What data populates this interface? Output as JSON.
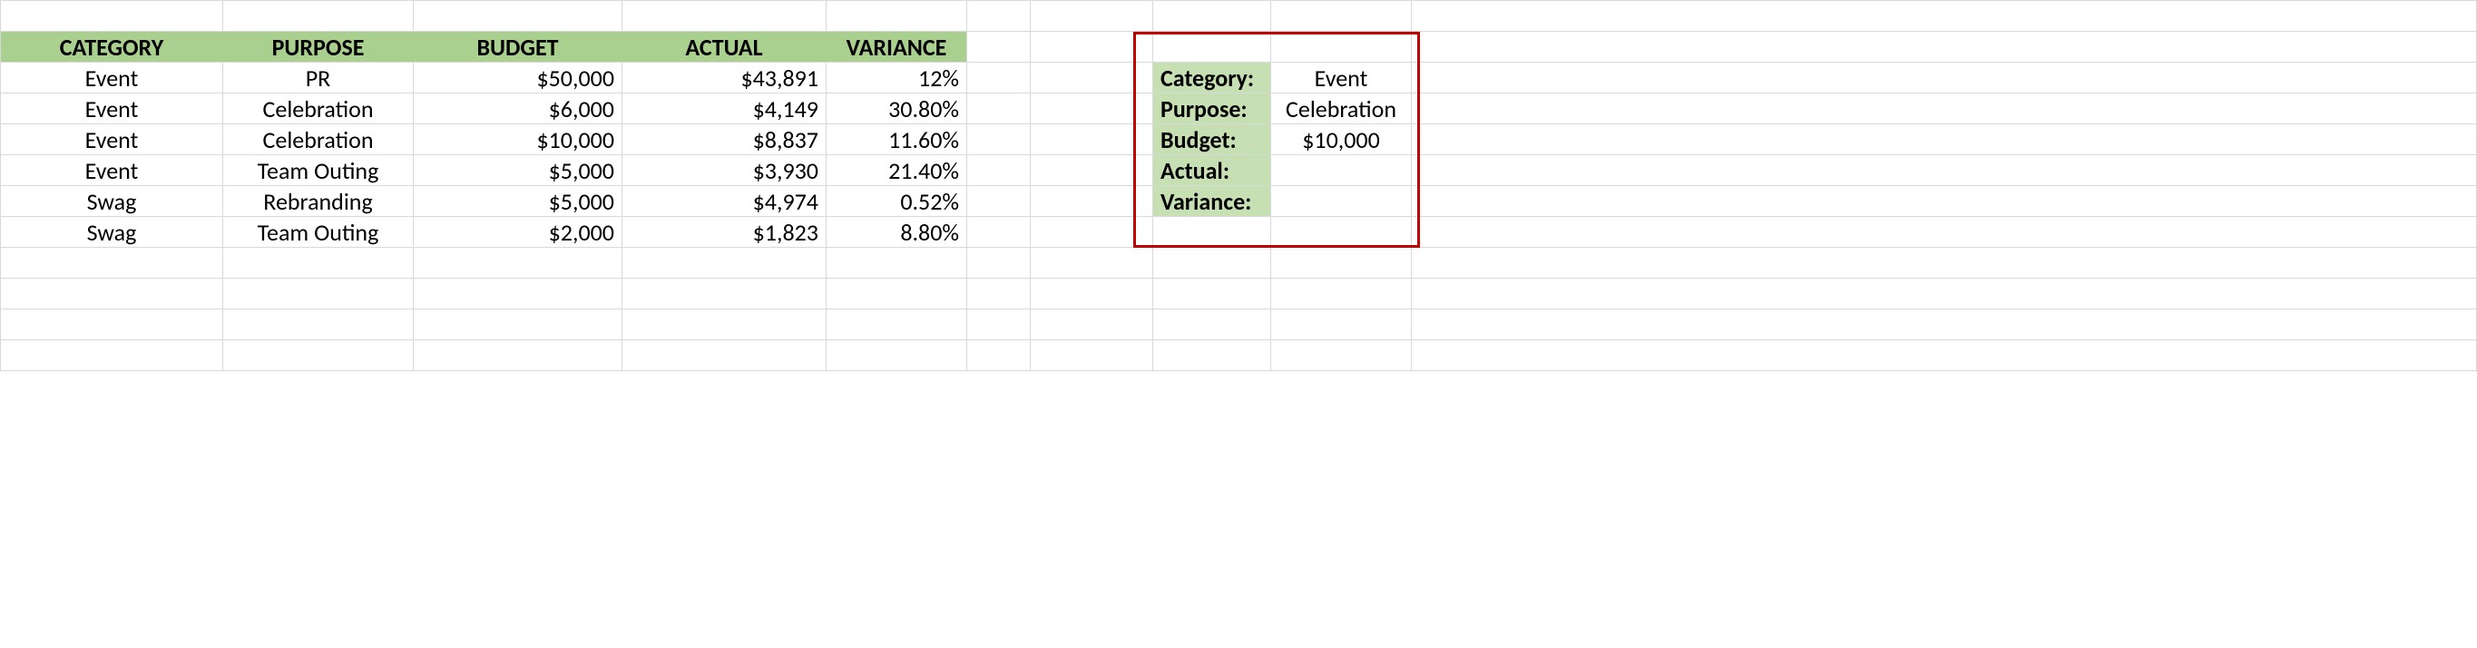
{
  "headers": {
    "category": "CATEGORY",
    "purpose": "PURPOSE",
    "budget": "BUDGET",
    "actual": "ACTUAL",
    "variance": "VARIANCE"
  },
  "rows": [
    {
      "category": "Event",
      "purpose": "PR",
      "budget": "$50,000",
      "actual": "$43,891",
      "variance": "12%"
    },
    {
      "category": "Event",
      "purpose": "Celebration",
      "budget": "$6,000",
      "actual": "$4,149",
      "variance": "30.80%"
    },
    {
      "category": "Event",
      "purpose": "Celebration",
      "budget": "$10,000",
      "actual": "$8,837",
      "variance": "11.60%"
    },
    {
      "category": "Event",
      "purpose": "Team Outing",
      "budget": "$5,000",
      "actual": "$3,930",
      "variance": "21.40%"
    },
    {
      "category": "Swag",
      "purpose": "Rebranding",
      "budget": "$5,000",
      "actual": "$4,974",
      "variance": "0.52%"
    },
    {
      "category": "Swag",
      "purpose": "Team Outing",
      "budget": "$2,000",
      "actual": "$1,823",
      "variance": "8.80%"
    }
  ],
  "lookup": {
    "labels": {
      "category": "Category:",
      "purpose": "Purpose:",
      "budget": "Budget:",
      "actual": "Actual:",
      "variance": "Variance:"
    },
    "values": {
      "category": "Event",
      "purpose": "Celebration",
      "budget": "$10,000",
      "actual": "",
      "variance": ""
    }
  },
  "colors": {
    "header_bg": "#a9d08e",
    "label_bg": "#c6e0b4",
    "grid": "#d9d9d9",
    "redbox": "#c00000"
  }
}
